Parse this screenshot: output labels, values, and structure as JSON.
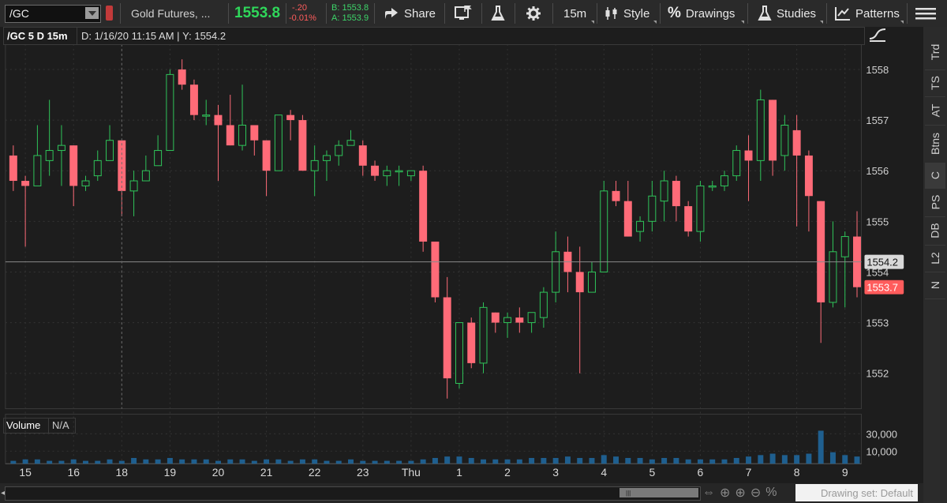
{
  "toolbar": {
    "symbol": "/GC",
    "description": "Gold Futures, ...",
    "last_price": "1553.8",
    "net_change": "-.20",
    "pct_change": "-0.01%",
    "bid": "B: 1553.8",
    "ask": "A: 1553.9",
    "share_label": "Share",
    "timeframe_label": "15m",
    "style_label": "Style",
    "drawings_label": "Drawings",
    "studies_label": "Studies",
    "patterns_label": "Patterns"
  },
  "chart_header": {
    "symbol_period": "/GC 5 D 15m",
    "cursor_info": "D: 1/16/20 11:15 AM",
    "cursor_y": "Y: 1554.2"
  },
  "volume_header": {
    "label": "Volume",
    "value": "N/A"
  },
  "right_rail": {
    "tabs": [
      "Trd",
      "TS",
      "AT",
      "Btns",
      "C",
      "PS",
      "DB",
      "L2",
      "N"
    ],
    "active": "C"
  },
  "drawing_set": "Drawing set: Default",
  "colors": {
    "up": "#2fc55a",
    "down": "#ff6b78",
    "background": "#1d1d1d",
    "grid": "#3a3a3a",
    "volume_bar": "#1f5f8f",
    "last_price_tag": "#ff5c5c",
    "crosshair_tag": "#d9d9d9"
  },
  "chart_data": {
    "type": "candlestick",
    "interval": "15m",
    "y_ticks": [
      1552,
      1553,
      1554,
      1555,
      1556,
      1557,
      1558
    ],
    "x_tick_labels": [
      "15",
      "16",
      "18",
      "19",
      "20",
      "21",
      "22",
      "23",
      "Thu",
      "1",
      "2",
      "3",
      "4",
      "5",
      "6",
      "7",
      "8",
      "9"
    ],
    "ylim": [
      1551.3,
      1558.5
    ],
    "crosshair_price": "1554.2",
    "last_price_label": "1553.7",
    "volume_ticks": [
      "10,000",
      "30,000"
    ],
    "candles": [
      {
        "o": 1556.3,
        "h": 1556.5,
        "l": 1555.6,
        "c": 1555.8
      },
      {
        "o": 1555.8,
        "h": 1555.9,
        "l": 1554.5,
        "c": 1555.7
      },
      {
        "o": 1555.7,
        "h": 1556.9,
        "l": 1555.7,
        "c": 1556.3
      },
      {
        "o": 1556.2,
        "h": 1557.4,
        "l": 1555.9,
        "c": 1556.4
      },
      {
        "o": 1556.4,
        "h": 1556.9,
        "l": 1555.7,
        "c": 1556.5
      },
      {
        "o": 1556.5,
        "h": 1556.5,
        "l": 1555.3,
        "c": 1555.7
      },
      {
        "o": 1555.7,
        "h": 1555.9,
        "l": 1555.6,
        "c": 1555.8
      },
      {
        "o": 1555.9,
        "h": 1556.4,
        "l": 1555.8,
        "c": 1556.2
      },
      {
        "o": 1556.2,
        "h": 1556.9,
        "l": 1556.2,
        "c": 1556.6
      },
      {
        "o": 1556.6,
        "h": 1556.6,
        "l": 1555.1,
        "c": 1555.6
      },
      {
        "o": 1555.6,
        "h": 1556.0,
        "l": 1555.1,
        "c": 1555.8
      },
      {
        "o": 1555.8,
        "h": 1556.3,
        "l": 1555.8,
        "c": 1556.0
      },
      {
        "o": 1556.1,
        "h": 1556.7,
        "l": 1556.1,
        "c": 1556.4
      },
      {
        "o": 1556.4,
        "h": 1558.0,
        "l": 1556.4,
        "c": 1557.9
      },
      {
        "o": 1558.0,
        "h": 1558.2,
        "l": 1557.6,
        "c": 1557.7
      },
      {
        "o": 1557.7,
        "h": 1557.8,
        "l": 1557.0,
        "c": 1557.1
      },
      {
        "o": 1557.1,
        "h": 1557.4,
        "l": 1556.9,
        "c": 1557.1
      },
      {
        "o": 1557.1,
        "h": 1557.3,
        "l": 1555.8,
        "c": 1556.9
      },
      {
        "o": 1556.9,
        "h": 1557.5,
        "l": 1556.5,
        "c": 1556.5
      },
      {
        "o": 1556.5,
        "h": 1557.7,
        "l": 1556.4,
        "c": 1556.9
      },
      {
        "o": 1556.9,
        "h": 1556.9,
        "l": 1556.3,
        "c": 1556.6
      },
      {
        "o": 1556.6,
        "h": 1556.6,
        "l": 1555.5,
        "c": 1556.0
      },
      {
        "o": 1556.0,
        "h": 1557.1,
        "l": 1556.0,
        "c": 1557.1
      },
      {
        "o": 1557.1,
        "h": 1557.2,
        "l": 1556.6,
        "c": 1557.0
      },
      {
        "o": 1557.0,
        "h": 1557.1,
        "l": 1556.0,
        "c": 1556.0
      },
      {
        "o": 1556.0,
        "h": 1556.5,
        "l": 1555.5,
        "c": 1556.2
      },
      {
        "o": 1556.2,
        "h": 1556.4,
        "l": 1555.8,
        "c": 1556.3
      },
      {
        "o": 1556.3,
        "h": 1556.6,
        "l": 1556.1,
        "c": 1556.5
      },
      {
        "o": 1556.5,
        "h": 1556.8,
        "l": 1556.5,
        "c": 1556.6
      },
      {
        "o": 1556.5,
        "h": 1556.6,
        "l": 1555.9,
        "c": 1556.1
      },
      {
        "o": 1556.1,
        "h": 1556.2,
        "l": 1555.8,
        "c": 1555.9
      },
      {
        "o": 1555.9,
        "h": 1556.1,
        "l": 1555.7,
        "c": 1556.0
      },
      {
        "o": 1556.0,
        "h": 1556.1,
        "l": 1555.7,
        "c": 1556.0
      },
      {
        "o": 1555.9,
        "h": 1556.0,
        "l": 1555.8,
        "c": 1556.0
      },
      {
        "o": 1556.0,
        "h": 1556.1,
        "l": 1554.4,
        "c": 1554.6
      },
      {
        "o": 1554.6,
        "h": 1554.6,
        "l": 1553.4,
        "c": 1553.5
      },
      {
        "o": 1553.5,
        "h": 1553.9,
        "l": 1551.5,
        "c": 1551.9
      },
      {
        "o": 1551.8,
        "h": 1553.0,
        "l": 1551.7,
        "c": 1553.0
      },
      {
        "o": 1553.0,
        "h": 1553.1,
        "l": 1552.1,
        "c": 1552.2
      },
      {
        "o": 1552.2,
        "h": 1553.4,
        "l": 1552.0,
        "c": 1553.3
      },
      {
        "o": 1553.2,
        "h": 1553.2,
        "l": 1552.8,
        "c": 1553.0
      },
      {
        "o": 1553.0,
        "h": 1553.2,
        "l": 1552.7,
        "c": 1553.1
      },
      {
        "o": 1553.1,
        "h": 1553.3,
        "l": 1552.8,
        "c": 1553.0
      },
      {
        "o": 1553.0,
        "h": 1553.2,
        "l": 1552.8,
        "c": 1553.2
      },
      {
        "o": 1553.1,
        "h": 1553.7,
        "l": 1552.9,
        "c": 1553.6
      },
      {
        "o": 1553.6,
        "h": 1554.8,
        "l": 1553.4,
        "c": 1554.4
      },
      {
        "o": 1554.4,
        "h": 1554.7,
        "l": 1553.6,
        "c": 1554.0
      },
      {
        "o": 1554.0,
        "h": 1554.5,
        "l": 1552.0,
        "c": 1553.6
      },
      {
        "o": 1553.6,
        "h": 1554.2,
        "l": 1553.6,
        "c": 1554.0
      },
      {
        "o": 1554.0,
        "h": 1555.8,
        "l": 1554.0,
        "c": 1555.6
      },
      {
        "o": 1555.6,
        "h": 1555.8,
        "l": 1555.3,
        "c": 1555.4
      },
      {
        "o": 1555.4,
        "h": 1555.8,
        "l": 1554.7,
        "c": 1554.7
      },
      {
        "o": 1554.8,
        "h": 1555.1,
        "l": 1554.6,
        "c": 1555.0
      },
      {
        "o": 1555.0,
        "h": 1555.8,
        "l": 1554.8,
        "c": 1555.5
      },
      {
        "o": 1555.4,
        "h": 1556.0,
        "l": 1555.0,
        "c": 1555.8
      },
      {
        "o": 1555.8,
        "h": 1555.9,
        "l": 1555.0,
        "c": 1555.3
      },
      {
        "o": 1555.3,
        "h": 1555.4,
        "l": 1554.7,
        "c": 1554.8
      },
      {
        "o": 1554.8,
        "h": 1555.8,
        "l": 1554.6,
        "c": 1555.7
      },
      {
        "o": 1555.7,
        "h": 1555.8,
        "l": 1555.6,
        "c": 1555.7
      },
      {
        "o": 1555.7,
        "h": 1556.0,
        "l": 1555.6,
        "c": 1555.9
      },
      {
        "o": 1555.9,
        "h": 1556.5,
        "l": 1555.8,
        "c": 1556.4
      },
      {
        "o": 1556.4,
        "h": 1556.7,
        "l": 1555.4,
        "c": 1556.2
      },
      {
        "o": 1556.2,
        "h": 1557.6,
        "l": 1555.8,
        "c": 1557.4
      },
      {
        "o": 1557.4,
        "h": 1557.4,
        "l": 1555.9,
        "c": 1556.2
      },
      {
        "o": 1556.3,
        "h": 1557.1,
        "l": 1556.0,
        "c": 1556.9
      },
      {
        "o": 1556.8,
        "h": 1557.1,
        "l": 1554.9,
        "c": 1556.3
      },
      {
        "o": 1556.3,
        "h": 1556.4,
        "l": 1554.8,
        "c": 1555.5
      },
      {
        "o": 1555.4,
        "h": 1555.4,
        "l": 1552.6,
        "c": 1553.4
      },
      {
        "o": 1553.4,
        "h": 1555.0,
        "l": 1553.3,
        "c": 1554.4
      },
      {
        "o": 1554.3,
        "h": 1554.8,
        "l": 1553.3,
        "c": 1554.7
      },
      {
        "o": 1554.7,
        "h": 1555.2,
        "l": 1553.5,
        "c": 1553.7
      }
    ],
    "volume": [
      2,
      3,
      3,
      2,
      2,
      3,
      2,
      2,
      3,
      2,
      4,
      3,
      3,
      4,
      3,
      3,
      3,
      2,
      3,
      3,
      2,
      3,
      3,
      2,
      3,
      3,
      2,
      2,
      3,
      2,
      2,
      2,
      2,
      2,
      3,
      4,
      5,
      5,
      4,
      3,
      3,
      3,
      3,
      4,
      4,
      4,
      5,
      4,
      4,
      6,
      5,
      4,
      4,
      3,
      4,
      4,
      3,
      3,
      3,
      3,
      4,
      5,
      6,
      7,
      6,
      6,
      7,
      23,
      8,
      6,
      5
    ]
  }
}
